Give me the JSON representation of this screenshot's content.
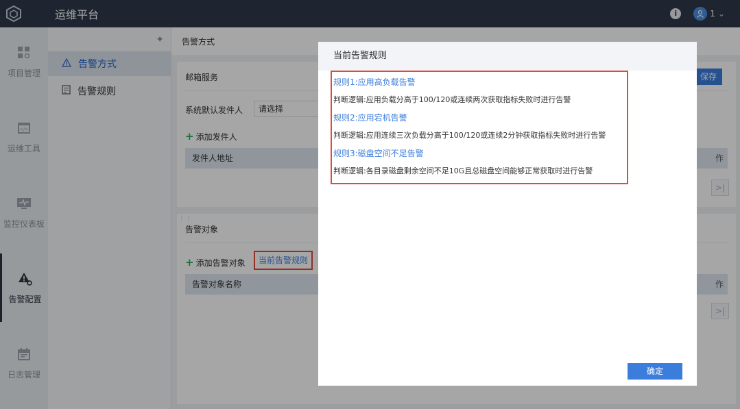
{
  "app": {
    "title": "运维平台"
  },
  "topbar": {
    "user_name": "1"
  },
  "leftnav": {
    "items": [
      {
        "label": "项目管理",
        "icon": "grid-icon"
      },
      {
        "label": "运维工具",
        "icon": "code-window-icon"
      },
      {
        "label": "监控仪表板",
        "icon": "monitor-icon"
      },
      {
        "label": "告警配置",
        "icon": "alert-gear-icon"
      },
      {
        "label": "日志管理",
        "icon": "calendar-icon"
      }
    ]
  },
  "subnav": {
    "items": [
      {
        "label": "告警方式",
        "icon": "warning-triangle-icon"
      },
      {
        "label": "告警规则",
        "icon": "document-icon"
      }
    ]
  },
  "main": {
    "header": "告警方式",
    "email_panel": {
      "title": "邮箱服务",
      "save_label": "保存",
      "sender_label": "系统默认发件人",
      "sender_placeholder": "请选择",
      "add_sender": "添加发件人",
      "table_header": "发件人地址",
      "table_header_right": "作"
    },
    "target_panel": {
      "title": "告警对象",
      "add_target": "添加告警对象",
      "rules_link": "当前告警规则",
      "table_header": "告警对象名称",
      "table_header_right": "作"
    }
  },
  "modal": {
    "title": "当前告警规则",
    "rules": [
      {
        "title": "规则1:应用高负载告警",
        "desc": "判断逻辑:应用负载分高于100/120或连续两次获取指标失败时进行告警"
      },
      {
        "title": "规则2:应用宕机告警",
        "desc": "判断逻辑:应用连续三次负载分高于100/120或连续2分钟获取指标失败时进行告警"
      },
      {
        "title": "规则3:磁盘空间不足告警",
        "desc": "判断逻辑:各目录磁盘剩余空间不足10G且总磁盘空间能够正常获取时进行告警"
      }
    ],
    "ok_label": "确定"
  },
  "colors": {
    "topbar": "#2f3a4c",
    "accent": "#3b7ddd",
    "highlight_border": "#e04a3b"
  }
}
